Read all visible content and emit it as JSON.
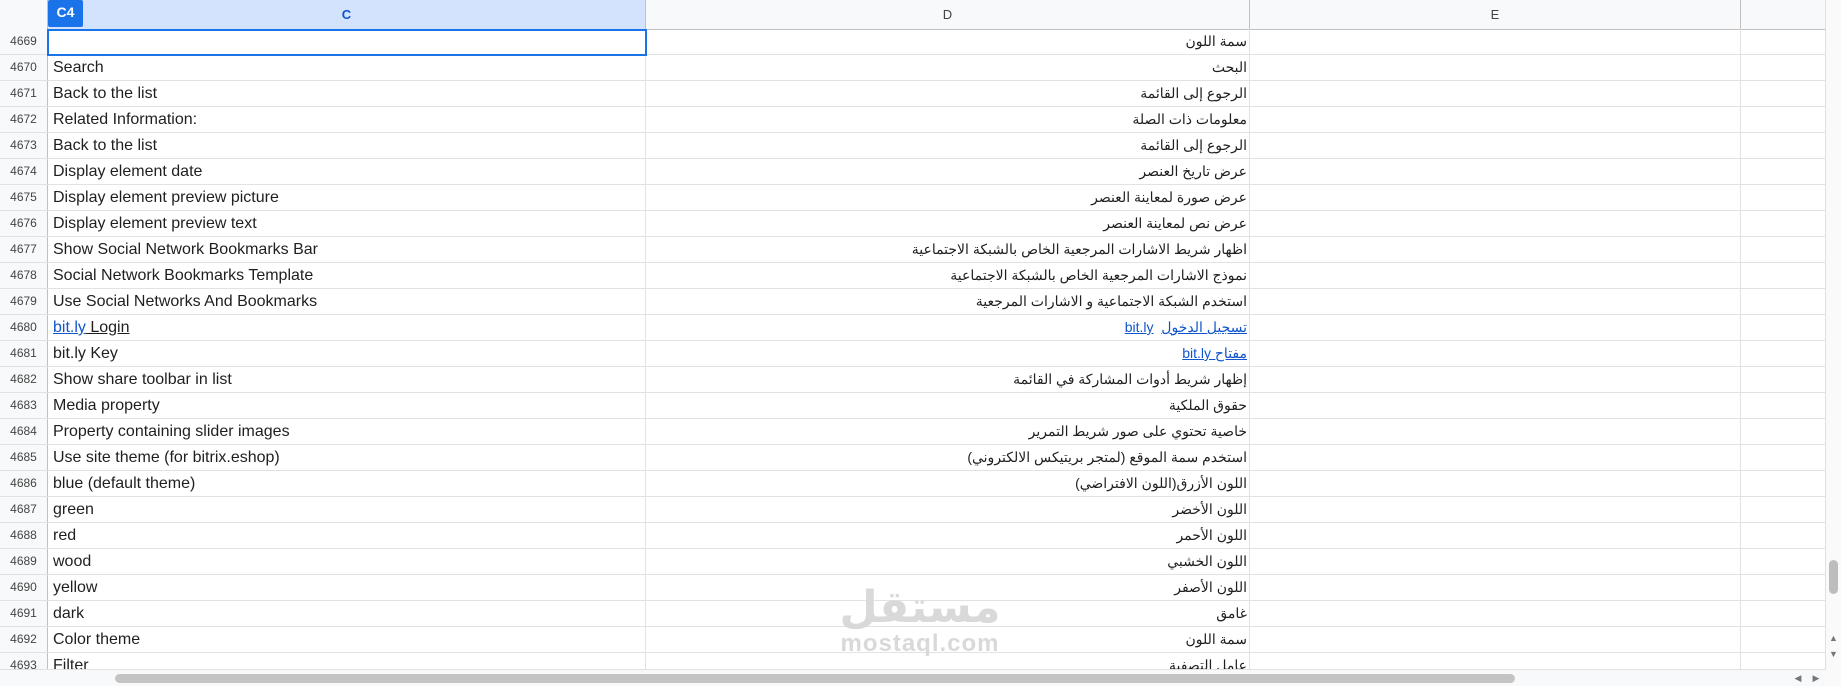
{
  "name_box": "C4",
  "columns": [
    {
      "label": "C",
      "selected": true
    },
    {
      "label": "D",
      "selected": false
    },
    {
      "label": "E",
      "selected": false
    }
  ],
  "rows": [
    {
      "num": "4669",
      "c": "",
      "d": "سمة اللون"
    },
    {
      "num": "4670",
      "c": "Search",
      "d": "البحث"
    },
    {
      "num": "4671",
      "c": "Back to the list",
      "d": "الرجوع إلى القائمة"
    },
    {
      "num": "4672",
      "c": "Related Information:",
      "d": "معلومات ذات الصلة"
    },
    {
      "num": "4673",
      "c": "Back to the list",
      "d": "الرجوع إلى القائمة"
    },
    {
      "num": "4674",
      "c": "Display element date",
      "d": "عرض تاريخ العنصر"
    },
    {
      "num": "4675",
      "c": "Display element preview picture",
      "d": "عرض صورة لمعاينة العنصر"
    },
    {
      "num": "4676",
      "c": "Display element preview text",
      "d": "عرض نص لمعاينة العنصر"
    },
    {
      "num": "4677",
      "c": "Show Social Network Bookmarks Bar",
      "d": "اظهار شريط الاشارات المرجعية الخاص بالشبكة الاجتماعية"
    },
    {
      "num": "4678",
      "c": "Social Network Bookmarks Template",
      "d": "نموذج الاشارات المرجعية الخاص بالشبكة الاجتماعية"
    },
    {
      "num": "4679",
      "c": "Use Social Networks And Bookmarks",
      "d": "استخدم الشبكة الاجتماعية و الاشارات المرجعية"
    },
    {
      "num": "4680",
      "c_link": "bit.ly",
      "c_rest": " Login",
      "d_link": "تسجيل الدخول",
      "d_link2": "bit.ly"
    },
    {
      "num": "4681",
      "c": "bit.ly Key",
      "d_link": "مفتاح bit.ly"
    },
    {
      "num": "4682",
      "c": "Show share toolbar in list",
      "d": "إظهار شريط أدوات المشاركة في القائمة"
    },
    {
      "num": "4683",
      "c": "Media property",
      "d": "حقوق الملكية"
    },
    {
      "num": "4684",
      "c": "Property containing slider images",
      "d": "خاصية تحتوي على صور شريط التمرير"
    },
    {
      "num": "4685",
      "c": "Use site theme (for bitrix.eshop)",
      "d": "استخدم سمة الموقع (لمتجر بريتيكس الالكتروني)"
    },
    {
      "num": "4686",
      "c": "blue (default theme)",
      "d": "اللون الأزرق(اللون الافتراضي)"
    },
    {
      "num": "4687",
      "c": "green",
      "d": "اللون الأخضر"
    },
    {
      "num": "4688",
      "c": "red",
      "d": "اللون الأحمر"
    },
    {
      "num": "4689",
      "c": "wood",
      "d": "اللون الخشبي"
    },
    {
      "num": "4690",
      "c": "yellow",
      "d": "اللون الأصفر"
    },
    {
      "num": "4691",
      "c": "dark",
      "d": "غامق"
    },
    {
      "num": "4692",
      "c": "Color theme",
      "d": "سمة اللون"
    },
    {
      "num": "4693",
      "c": "Filter",
      "d": "عامل التصفية"
    }
  ],
  "watermark": {
    "arabic": "مستقل",
    "latin": "mostaql.com"
  },
  "colors": {
    "selection": "#1a73e8",
    "link": "#1155cc",
    "header_bg": "#f8f9fa"
  }
}
